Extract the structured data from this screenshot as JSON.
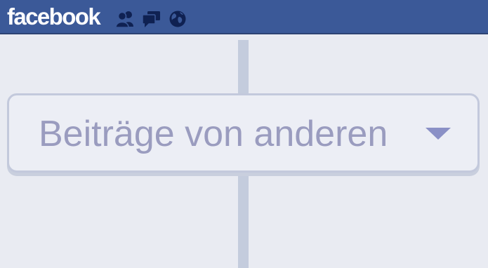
{
  "header": {
    "logo_text": "facebook",
    "icons": [
      "friend-requests-icon",
      "messages-icon",
      "notifications-globe-icon"
    ],
    "colors": {
      "bar": "#3b5998",
      "icon": "#0f2152"
    }
  },
  "timeline": {
    "filter_dropdown": {
      "label": "Beiträge von anderen",
      "caret_icon": "chevron-down-icon"
    }
  }
}
